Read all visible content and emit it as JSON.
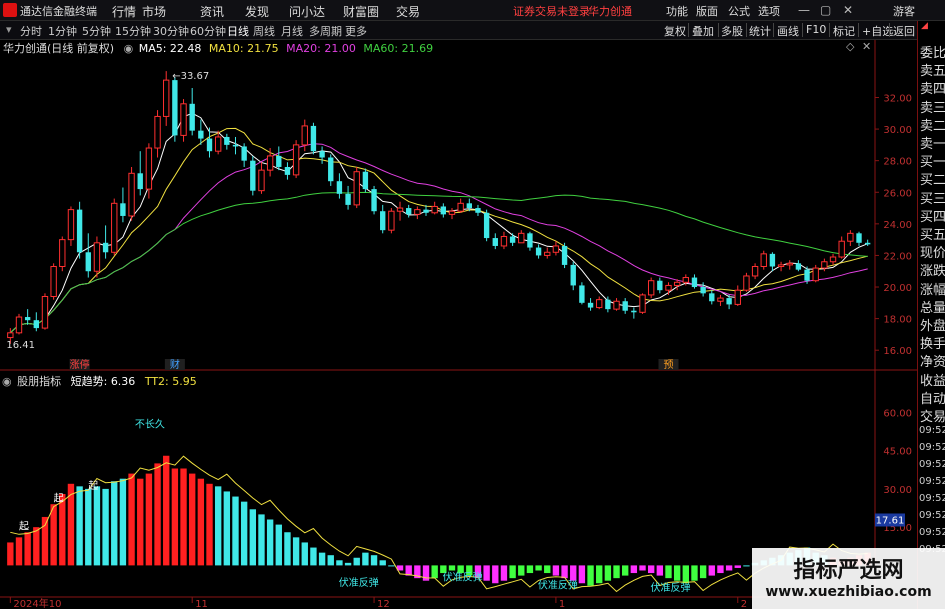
{
  "app": {
    "title": "通达信金融终端",
    "warning": "证券交易未登录",
    "stock_name": "华力创通",
    "menus": [
      "行情",
      "市场",
      "资讯",
      "发现",
      "问小达",
      "财富圈",
      "交易"
    ],
    "right_menus": [
      "功能",
      "版面",
      "公式",
      "选项"
    ],
    "guest": "游客"
  },
  "toolbar": {
    "periods": [
      "分时",
      "1分钟",
      "5分钟",
      "15分钟",
      "30分钟",
      "60分钟",
      "日线",
      "周线",
      "月线",
      "多周期",
      "更多"
    ],
    "active_period": "日线",
    "right_buttons": [
      "复权",
      "叠加",
      "多股",
      "统计",
      "画线",
      "F10",
      "标记",
      "+自选",
      "返回"
    ]
  },
  "main": {
    "title": "华力创通(日线 前复权)",
    "ma": [
      {
        "label": "MA5: 22.48",
        "color": "#ffffff"
      },
      {
        "label": "MA10: 21.75",
        "color": "#f0e040"
      },
      {
        "label": "MA20: 21.00",
        "color": "#e040e0"
      },
      {
        "label": "MA60: 21.69",
        "color": "#40d040"
      }
    ],
    "high_label": "33.67",
    "low_label": "16.41",
    "events": [
      {
        "label": "涨停",
        "color": "#ff4040"
      },
      {
        "label": "财",
        "color": "#40a0ff"
      },
      {
        "label": "预",
        "color": "#ffa020"
      }
    ]
  },
  "indicator": {
    "title": "股朋指标",
    "name": "短趋势",
    "v1": "6.36",
    "tt2": "TT2: 5.95",
    "current": "17.61",
    "y_ticks": [
      "60.00",
      "45.00",
      "30.00",
      "15.00"
    ],
    "notes": [
      "起",
      "不长久",
      "伏准反弹"
    ]
  },
  "axis": {
    "x_labels": [
      "2024年10",
      "11",
      "12",
      "1",
      "2"
    ]
  },
  "right_panel": {
    "labels": [
      "委比",
      "卖五",
      "卖四",
      "卖三",
      "卖二",
      "卖一",
      "买一",
      "买二",
      "买三",
      "买四",
      "买五",
      "现价",
      "涨跌",
      "涨幅",
      "总量",
      "外盘",
      "换手",
      "净资",
      "收益",
      "自动",
      "交易"
    ],
    "times": [
      "09:52",
      "09:52",
      "09:52",
      "09:52",
      "09:52",
      "09:52",
      "09:52",
      "09:52"
    ]
  },
  "watermark": {
    "line1": "指标严选网",
    "line2": "www.xuezhibiao.com"
  },
  "chart_data": [
    {
      "type": "candlestick",
      "y_ticks": [
        32,
        30,
        28,
        26,
        24,
        22,
        20,
        18,
        16
      ],
      "ylim": [
        15,
        34.5
      ],
      "candles": [
        [
          16.8,
          17.4,
          16.4,
          17.1
        ],
        [
          17.1,
          18.3,
          17.0,
          18.1
        ],
        [
          18.1,
          18.6,
          17.6,
          17.9
        ],
        [
          17.9,
          18.4,
          17.2,
          17.4
        ],
        [
          17.4,
          19.6,
          17.3,
          19.4
        ],
        [
          19.4,
          21.5,
          19.2,
          21.3
        ],
        [
          21.3,
          23.2,
          21.0,
          23.0
        ],
        [
          23.0,
          25.1,
          22.6,
          24.9
        ],
        [
          24.9,
          25.4,
          21.8,
          22.2
        ],
        [
          22.2,
          23.4,
          20.6,
          21.0
        ],
        [
          21.0,
          23.2,
          20.6,
          22.8
        ],
        [
          22.8,
          23.9,
          21.8,
          22.2
        ],
        [
          22.2,
          25.6,
          22.0,
          25.3
        ],
        [
          25.3,
          26.3,
          24.1,
          24.5
        ],
        [
          24.5,
          27.6,
          24.2,
          27.2
        ],
        [
          27.2,
          28.6,
          25.8,
          26.2
        ],
        [
          26.2,
          29.1,
          25.6,
          28.8
        ],
        [
          28.8,
          31.2,
          28.2,
          30.8
        ],
        [
          30.8,
          33.67,
          30.2,
          33.1
        ],
        [
          33.1,
          33.3,
          29.2,
          29.6
        ],
        [
          29.6,
          31.9,
          29.2,
          31.6
        ],
        [
          31.6,
          32.6,
          29.6,
          29.9
        ],
        [
          29.9,
          30.6,
          29.0,
          29.4
        ],
        [
          29.4,
          30.1,
          28.2,
          28.6
        ],
        [
          28.6,
          29.9,
          28.4,
          29.5
        ],
        [
          29.5,
          29.7,
          28.7,
          29.0
        ],
        [
          29.0,
          29.5,
          28.4,
          28.9
        ],
        [
          28.9,
          29.1,
          27.6,
          28.0
        ],
        [
          28.0,
          28.3,
          25.8,
          26.1
        ],
        [
          26.1,
          27.9,
          25.9,
          27.4
        ],
        [
          27.4,
          28.8,
          27.0,
          28.3
        ],
        [
          28.3,
          28.9,
          27.4,
          27.6
        ],
        [
          27.6,
          27.9,
          26.8,
          27.1
        ],
        [
          27.1,
          29.3,
          26.9,
          29.0
        ],
        [
          29.0,
          30.6,
          28.6,
          30.2
        ],
        [
          30.2,
          30.4,
          28.4,
          28.6
        ],
        [
          28.6,
          28.9,
          27.8,
          28.2
        ],
        [
          28.2,
          28.4,
          26.4,
          26.7
        ],
        [
          26.7,
          27.2,
          25.6,
          25.9
        ],
        [
          25.9,
          26.4,
          24.9,
          25.2
        ],
        [
          25.2,
          27.6,
          25.0,
          27.3
        ],
        [
          27.3,
          27.5,
          26.0,
          26.2
        ],
        [
          26.2,
          26.4,
          24.6,
          24.8
        ],
        [
          24.8,
          25.2,
          23.4,
          23.6
        ],
        [
          23.6,
          25.0,
          23.4,
          24.8
        ],
        [
          24.8,
          25.4,
          24.2,
          25.0
        ],
        [
          25.0,
          25.2,
          24.4,
          24.6
        ],
        [
          24.6,
          25.1,
          24.3,
          24.9
        ],
        [
          24.9,
          25.2,
          24.5,
          24.7
        ],
        [
          24.7,
          25.4,
          24.6,
          25.1
        ],
        [
          25.1,
          25.3,
          24.4,
          24.6
        ],
        [
          24.6,
          25.0,
          24.3,
          24.8
        ],
        [
          24.8,
          25.6,
          24.7,
          25.3
        ],
        [
          25.3,
          25.6,
          24.8,
          25.0
        ],
        [
          25.0,
          25.2,
          24.5,
          24.7
        ],
        [
          24.7,
          24.9,
          22.9,
          23.1
        ],
        [
          23.1,
          23.4,
          22.4,
          22.6
        ],
        [
          22.6,
          23.5,
          22.4,
          23.2
        ],
        [
          23.2,
          23.4,
          22.6,
          22.8
        ],
        [
          22.8,
          23.6,
          22.8,
          23.4
        ],
        [
          23.4,
          23.5,
          22.3,
          22.5
        ],
        [
          22.5,
          22.7,
          21.8,
          22.0
        ],
        [
          22.0,
          22.5,
          21.8,
          22.2
        ],
        [
          22.2,
          22.9,
          22.0,
          22.6
        ],
        [
          22.6,
          22.8,
          21.2,
          21.4
        ],
        [
          21.4,
          21.6,
          19.8,
          20.1
        ],
        [
          20.1,
          20.3,
          18.9,
          19.0
        ],
        [
          19.0,
          19.3,
          18.5,
          18.7
        ],
        [
          18.7,
          19.4,
          18.6,
          19.2
        ],
        [
          19.2,
          19.4,
          18.4,
          18.6
        ],
        [
          18.6,
          19.3,
          18.5,
          19.1
        ],
        [
          19.1,
          19.3,
          18.3,
          18.5
        ],
        [
          18.5,
          18.7,
          18.0,
          18.4
        ],
        [
          18.4,
          19.6,
          18.3,
          19.5
        ],
        [
          19.5,
          20.6,
          19.3,
          20.4
        ],
        [
          20.4,
          20.6,
          19.6,
          19.8
        ],
        [
          19.8,
          20.3,
          19.5,
          20.1
        ],
        [
          20.1,
          20.5,
          19.8,
          20.3
        ],
        [
          20.3,
          20.8,
          20.1,
          20.6
        ],
        [
          20.6,
          20.8,
          19.9,
          20.0
        ],
        [
          20.0,
          20.3,
          19.4,
          19.6
        ],
        [
          19.6,
          19.8,
          18.9,
          19.1
        ],
        [
          19.1,
          19.5,
          18.8,
          19.3
        ],
        [
          19.3,
          19.5,
          18.6,
          18.9
        ],
        [
          18.9,
          20.1,
          18.8,
          19.8
        ],
        [
          19.8,
          20.9,
          19.7,
          20.7
        ],
        [
          20.7,
          21.5,
          20.5,
          21.3
        ],
        [
          21.3,
          22.3,
          21.1,
          22.1
        ],
        [
          22.1,
          22.2,
          21.0,
          21.3
        ],
        [
          21.3,
          21.6,
          21.0,
          21.4
        ],
        [
          21.4,
          21.7,
          21.1,
          21.5
        ],
        [
          21.5,
          21.7,
          21.0,
          21.1
        ],
        [
          21.1,
          21.3,
          20.2,
          20.4
        ],
        [
          20.4,
          21.4,
          20.3,
          21.2
        ],
        [
          21.2,
          21.8,
          21.0,
          21.6
        ],
        [
          21.6,
          22.1,
          21.4,
          21.9
        ],
        [
          21.9,
          23.2,
          21.8,
          22.9
        ],
        [
          22.9,
          23.6,
          22.6,
          23.4
        ],
        [
          23.4,
          23.5,
          22.6,
          22.8
        ],
        [
          22.8,
          23.0,
          22.6,
          22.7
        ]
      ]
    },
    {
      "type": "bar",
      "series_name": "短趋势",
      "ylim": [
        -12,
        68
      ],
      "values": [
        9,
        11,
        13,
        15,
        19,
        24,
        28,
        32,
        31,
        30,
        31,
        30,
        33,
        34,
        36,
        34,
        36,
        40,
        43,
        38,
        38,
        36,
        34,
        32,
        31,
        29,
        27,
        25,
        22,
        20,
        18,
        16,
        13,
        11,
        9,
        7,
        5,
        4,
        2,
        1,
        3,
        5,
        4,
        2,
        0,
        -2,
        -4,
        -5,
        -6,
        -5,
        -3,
        -2,
        -3,
        -4,
        -5,
        -6,
        -7,
        -6,
        -5,
        -4,
        -3,
        -2,
        -3,
        -4,
        -5,
        -6,
        -7,
        -8,
        -7,
        -6,
        -5,
        -4,
        -3,
        -2,
        -3,
        -4,
        -5,
        -6,
        -7,
        -6,
        -5,
        -4,
        -3,
        -2,
        -1,
        0,
        1,
        2,
        3,
        4,
        5,
        6,
        7,
        5,
        4,
        3,
        2,
        3,
        4,
        5
      ]
    }
  ]
}
